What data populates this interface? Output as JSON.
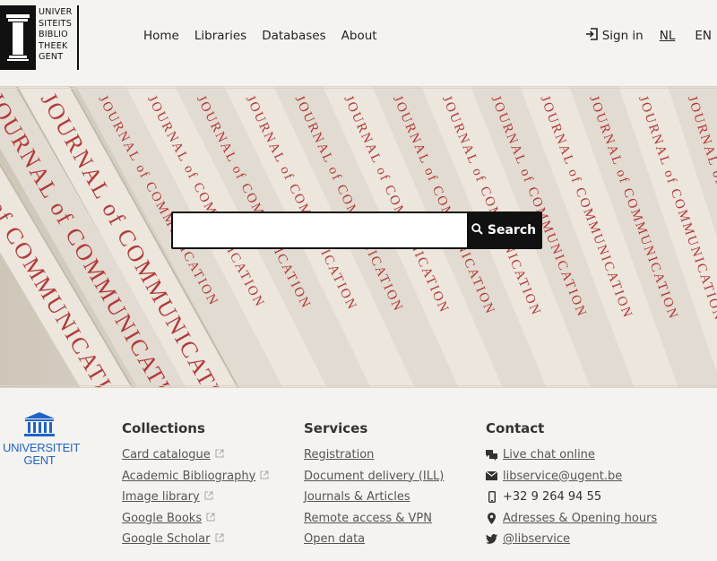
{
  "logo": {
    "lines": [
      "UNIVER",
      "SITEITS",
      "BIBLIO",
      "THEEK",
      "GENT"
    ]
  },
  "nav": {
    "items": [
      "Home",
      "Libraries",
      "Databases",
      "About"
    ]
  },
  "account": {
    "sign_in": "Sign in"
  },
  "languages": {
    "nl": "NL",
    "en": "EN",
    "active": "NL"
  },
  "search": {
    "placeholder": "",
    "value": "",
    "button_label": "Search"
  },
  "hero": {
    "spine_text": "JOURNAL of COMMUNICATION"
  },
  "footer": {
    "ugent_logo": {
      "line1": "UNIVERSITEIT",
      "line2": "GENT",
      "color": "#1e64c8"
    },
    "collections": {
      "title": "Collections",
      "links": [
        "Card catalogue",
        "Academic Bibliography",
        "Image library",
        "Google Books",
        "Google Scholar"
      ]
    },
    "services": {
      "title": "Services",
      "links": [
        "Registration",
        "Document delivery (ILL)",
        "Journals & Articles",
        "Remote access & VPN",
        "Open data"
      ]
    },
    "contact": {
      "title": "Contact",
      "items": [
        {
          "icon": "chat-icon",
          "text": "Live chat online",
          "link": true
        },
        {
          "icon": "envelope-icon",
          "text": "libservice@ugent.be",
          "link": true
        },
        {
          "icon": "phone-icon",
          "text": "+32 9 264 94 55",
          "link": false
        },
        {
          "icon": "map-marker-icon",
          "text": "Adresses & Opening hours",
          "link": true
        },
        {
          "icon": "twitter-icon",
          "text": "@libservice",
          "link": true
        }
      ]
    }
  }
}
